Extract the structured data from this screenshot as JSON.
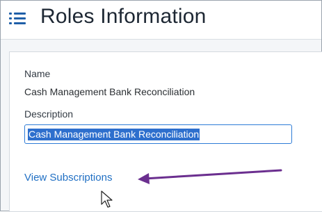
{
  "header": {
    "title": "Roles Information",
    "menu_icon": "hamburger-menu-icon"
  },
  "form": {
    "name_label": "Name",
    "name_value": "Cash Management Bank Reconciliation",
    "description_label": "Description",
    "description_value": "Cash Management Bank Reconciliation"
  },
  "links": {
    "view_subscriptions": "View Subscriptions"
  },
  "annotation": {
    "arrow_color": "#6b2f8f"
  },
  "colors": {
    "link": "#2170c4",
    "selection": "#2d6fcd",
    "accent": "#1f5fa8"
  }
}
